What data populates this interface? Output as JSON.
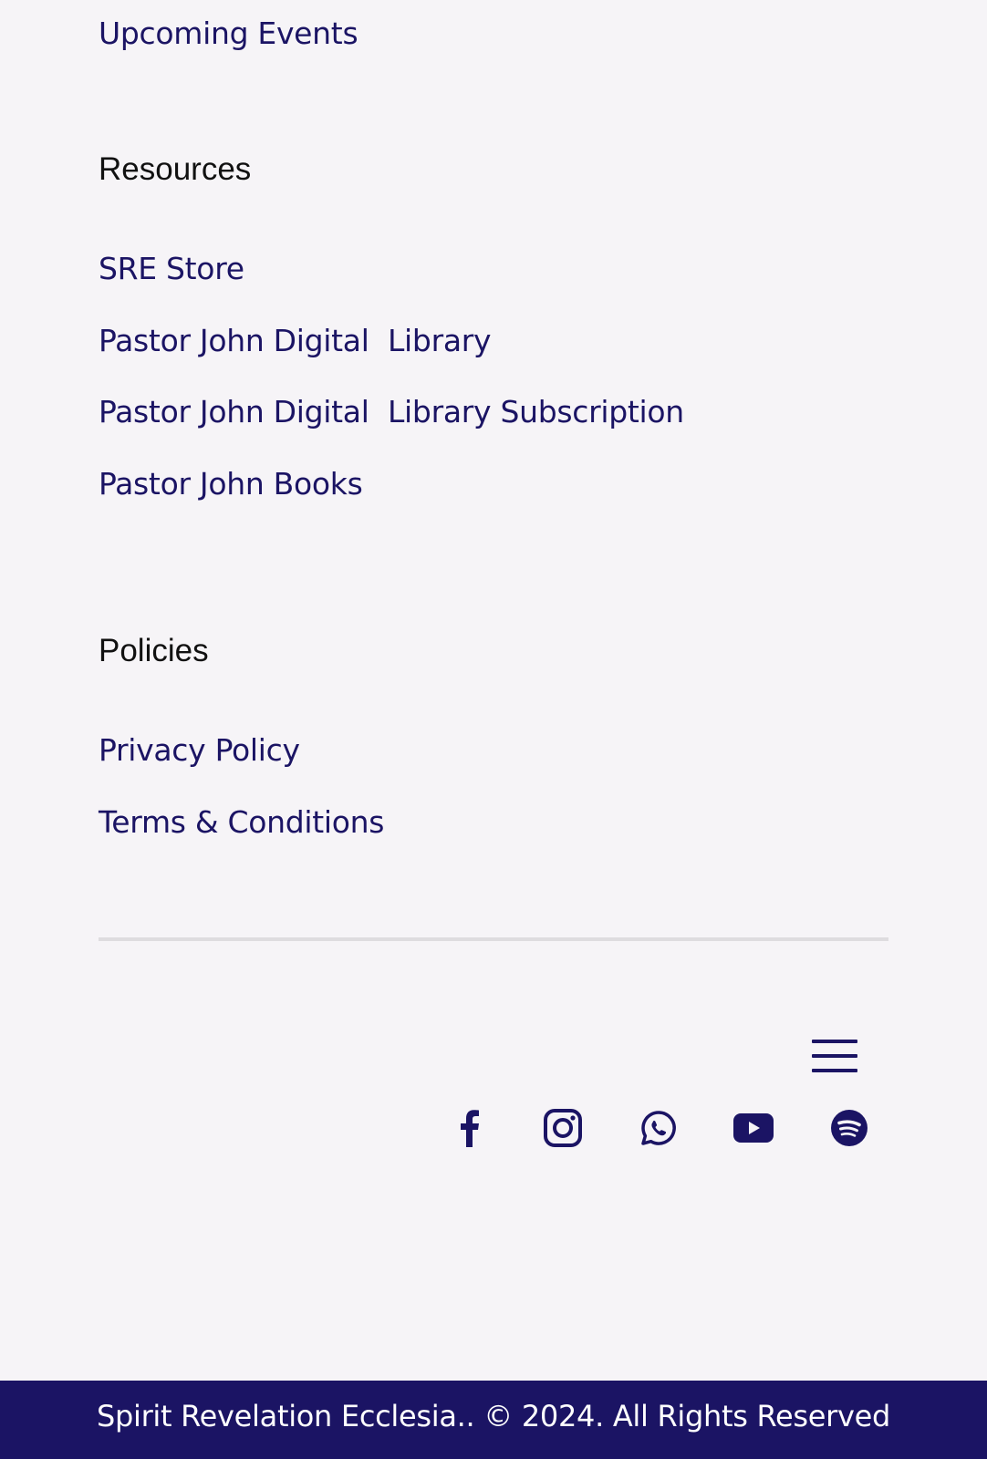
{
  "events": {
    "upcoming_label": "Upcoming Events"
  },
  "resources": {
    "heading": "Resources",
    "links": [
      {
        "label": "SRE Store"
      },
      {
        "label": "Pastor John Digital  Library"
      },
      {
        "label": "Pastor John Digital  Library Subscription"
      },
      {
        "label": "Pastor John Books"
      }
    ]
  },
  "policies": {
    "heading": "Policies",
    "links": [
      {
        "label": "Privacy Policy"
      },
      {
        "label": "Terms & Conditions"
      }
    ]
  },
  "menu": {
    "icon": "hamburger-menu-icon"
  },
  "social": [
    {
      "icon": "facebook-icon"
    },
    {
      "icon": "instagram-icon"
    },
    {
      "icon": "whatsapp-icon"
    },
    {
      "icon": "youtube-icon"
    },
    {
      "icon": "spotify-icon"
    }
  ],
  "footer": {
    "copyright": "Spirit Revelation Ecclesia.. © 2024. All Rights Reserved"
  },
  "colors": {
    "brand_navy": "#1b1464",
    "background": "#f6f4f7",
    "divider": "#dedcdf"
  }
}
